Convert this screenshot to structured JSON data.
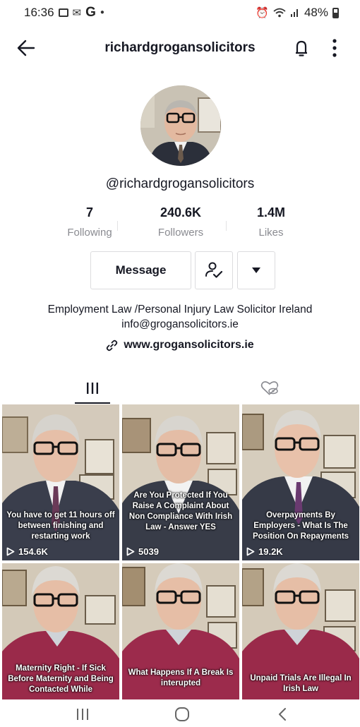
{
  "status_bar": {
    "time": "16:36",
    "left_icons": [
      "gallery-icon",
      "gmail-icon",
      "google-icon",
      "dot-icon"
    ],
    "g_letter": "G",
    "battery": "48%",
    "right_icons": [
      "alarm-icon",
      "wifi-icon",
      "signal-icon",
      "battery-icon"
    ]
  },
  "header": {
    "title": "richardgrogansolicitors"
  },
  "profile": {
    "username": "@richardgrogansolicitors",
    "stats": [
      {
        "value": "7",
        "label": "Following"
      },
      {
        "value": "240.6K",
        "label": "Followers"
      },
      {
        "value": "1.4M",
        "label": "Likes"
      }
    ],
    "message_label": "Message",
    "bio_line1": "Employment Law /Personal Injury Law Solicitor Ireland",
    "bio_line2": "info@grogansolicitors.ie",
    "website": "www.grogansolicitors.ie"
  },
  "tabs": [
    "videos-tab-icon",
    "liked-tab-icon"
  ],
  "videos": [
    {
      "caption": "You have to get 11 hours off between finishing and restarting work",
      "views": "154.6K"
    },
    {
      "caption": "Are You Protected If You Raise A Complaint About Non Compliance With Irish Law - Answer YES",
      "views": "5039"
    },
    {
      "caption": "Overpayments By Employers - What Is The Position On Repayments",
      "views": "19.2K"
    },
    {
      "caption": "Maternity Right - If Sick Before Maternity and Being Contacted While",
      "views": ""
    },
    {
      "caption": "What Happens If A Break Is interupted",
      "views": ""
    },
    {
      "caption": "Unpaid Trials Are Illegal In Irish Law",
      "views": ""
    }
  ],
  "colors": {
    "text": "#161823",
    "muted": "#8a8b91",
    "border": "#dcdcde"
  }
}
